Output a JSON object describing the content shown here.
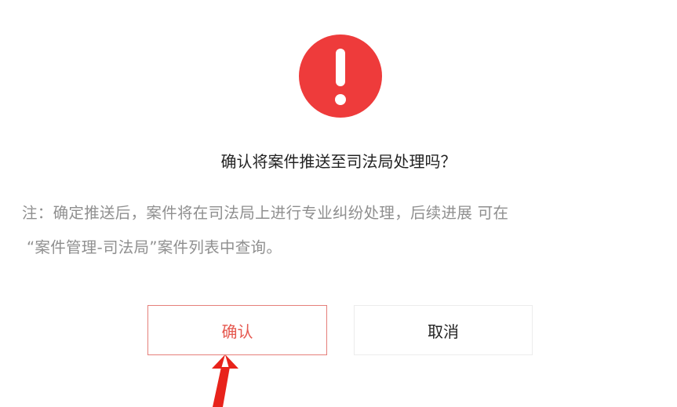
{
  "dialog": {
    "icon": "exclamation-circle-icon",
    "icon_color": "#ee3b3b",
    "title": "确认将案件推送至司法局处理吗？",
    "note_line1": "注：确定推送后，案件将在司法局上进行专业纠纷处理，后续进展 可在",
    "note_line2": "“案件管理-司法局”案件列表中查询。",
    "confirm_label": "确认",
    "cancel_label": "取消",
    "confirm_color": "#e5584f",
    "arrow_color": "#e8231b",
    "pointer": "red-arrow-icon"
  }
}
